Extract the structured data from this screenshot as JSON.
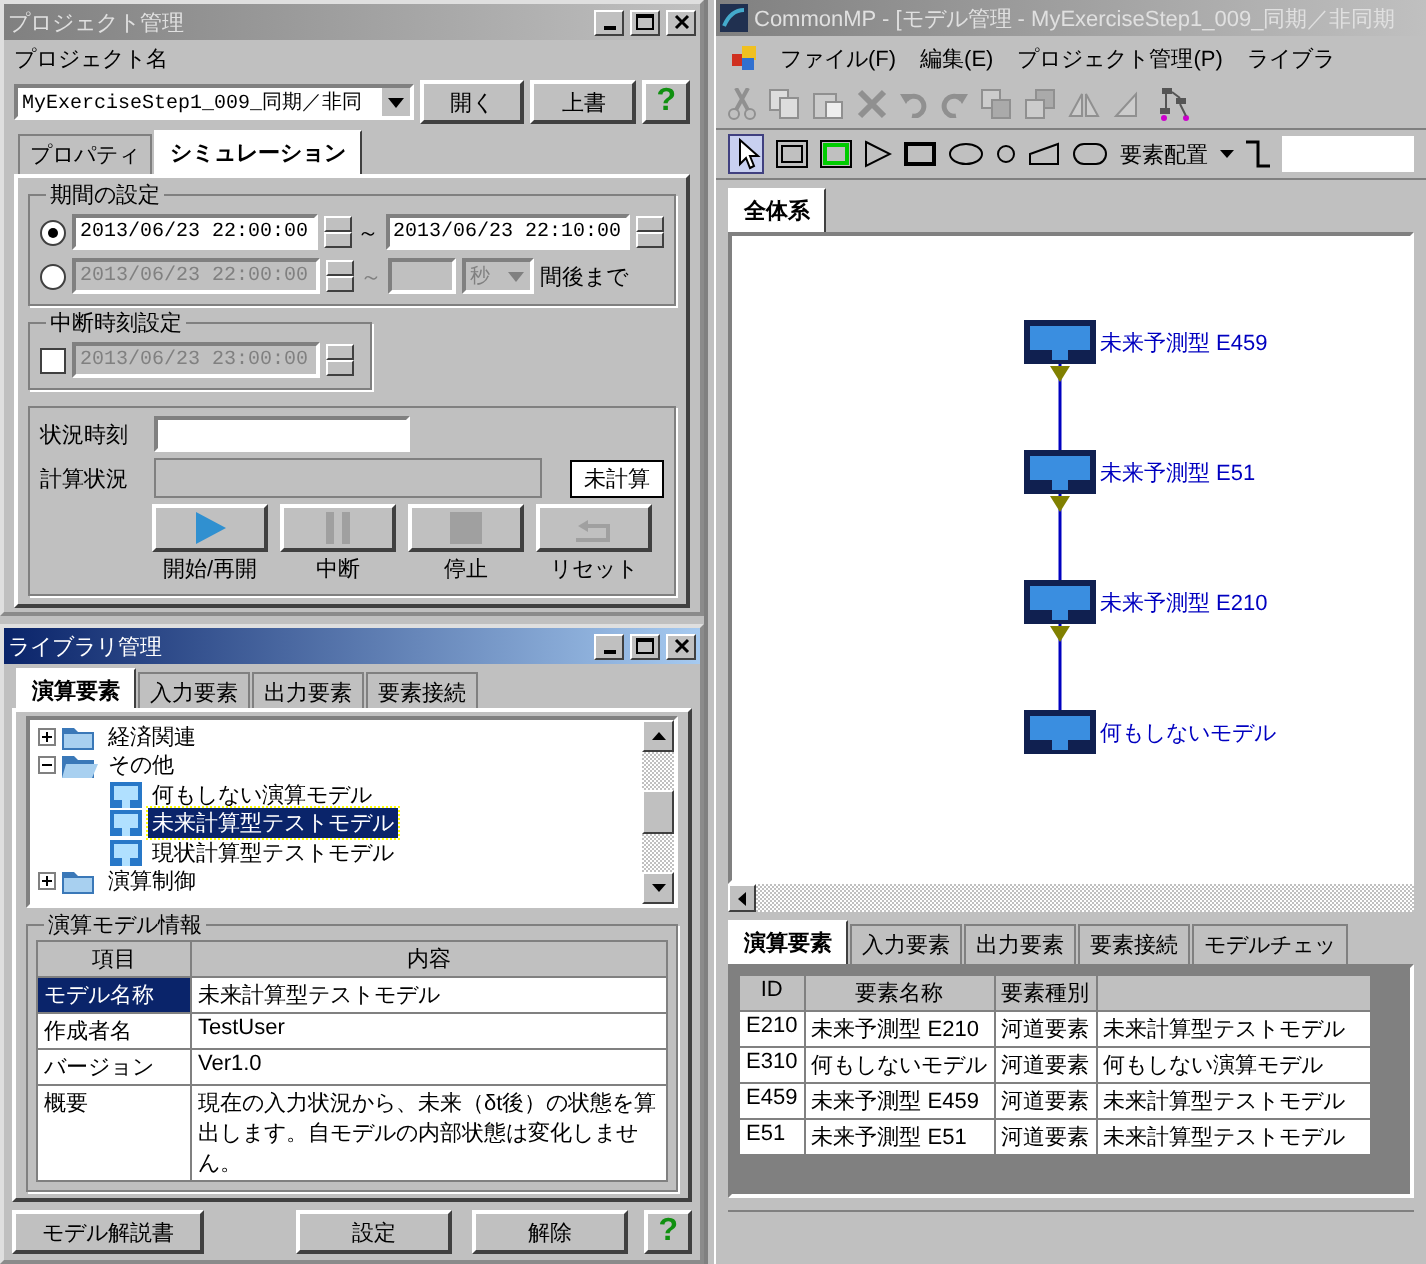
{
  "project_window": {
    "title": "プロジェクト管理",
    "active": false,
    "project_label": "プロジェクト名",
    "project_name": "MyExerciseStep1_009_同期／非同",
    "buttons": [
      "開く",
      "上書"
    ],
    "help": "?",
    "tabs": [
      {
        "label": "プロパティ",
        "selected": false
      },
      {
        "label": "シミュレーション",
        "selected": true
      }
    ],
    "period": {
      "title": "期間の設定",
      "options": [
        {
          "selected": true,
          "disabled": false,
          "start": "2013/06/23 22:00:00",
          "end": "2013/06/23 22:10:00"
        },
        {
          "selected": false,
          "disabled": true,
          "start": "2013/06/23 22:00:00",
          "unit": "秒",
          "suffix": "間後まで"
        }
      ],
      "separator": "～"
    },
    "interrupt": {
      "title": "中断時刻設定",
      "checked": false,
      "time": "2013/06/23 23:00:00"
    },
    "status_time_label": "状況時刻",
    "calc_label": "計算状況",
    "calc_progress": {
      "level": 0
    },
    "calc_status": "未計算",
    "controls": [
      {
        "kind": "play",
        "label": "開始/再開",
        "disabled": false
      },
      {
        "kind": "pause",
        "label": "中断",
        "disabled": true
      },
      {
        "kind": "stop",
        "label": "停止",
        "disabled": true
      },
      {
        "kind": "reset",
        "label": "リセット",
        "disabled": true
      }
    ]
  },
  "library_window": {
    "title": "ライブラリ管理",
    "active": true,
    "tabs": [
      {
        "label": "演算要素",
        "selected": true
      },
      {
        "label": "入力要素",
        "selected": false
      },
      {
        "label": "出力要素",
        "selected": false
      },
      {
        "label": "要素接続",
        "selected": false
      }
    ],
    "tree": [
      {
        "label": "経済関連",
        "expanded": false
      },
      {
        "label": "その他",
        "expanded": true,
        "children": [
          {
            "label": "何もしない演算モデル",
            "selected": false
          },
          {
            "label": "未来計算型テストモデル",
            "selected": true
          },
          {
            "label": "現状計算型テストモデル",
            "selected": false
          }
        ]
      },
      {
        "label": "演算制御",
        "expanded": false
      }
    ],
    "model_info": {
      "title": "演算モデル情報",
      "columns": [
        "項目",
        "内容"
      ],
      "rows": [
        {
          "label": "モデル名称",
          "value": "未来計算型テストモデル",
          "selected": true
        },
        {
          "label": "作成者名",
          "value": "TestUser",
          "selected": false
        },
        {
          "label": "バージョン",
          "value": "Ver1.0",
          "selected": false
        },
        {
          "label": "概要",
          "value": "現在の入力状況から、未来（δt後）の状態を算出します。自モデルの内部状態は変化しません。",
          "selected": false
        }
      ]
    },
    "buttons": [
      "モデル解説書",
      "設定",
      "解除"
    ],
    "help": "?"
  },
  "main_window": {
    "title": "CommonMP - [モデル管理 - MyExerciseStep1_009_同期／非同期",
    "active": false,
    "menu": [
      "ファイル(F)",
      "編集(E)",
      "プロジェクト管理(P)",
      "ライブラ"
    ],
    "layout_menu": "要素配置",
    "canvas_tab": {
      "label": "全体系",
      "selected": true
    },
    "nodes": [
      {
        "label": "未来予測型 E459"
      },
      {
        "label": "未来予測型 E51"
      },
      {
        "label": "未来予測型 E210"
      },
      {
        "label": "何もしないモデル"
      }
    ],
    "bottom_tabs": [
      {
        "label": "演算要素",
        "selected": true
      },
      {
        "label": "入力要素",
        "selected": false
      },
      {
        "label": "出力要素",
        "selected": false
      },
      {
        "label": "要素接続",
        "selected": false
      },
      {
        "label": "モデルチェッ",
        "selected": false
      }
    ],
    "table": {
      "columns": [
        "ID",
        "要素名称",
        "要素種別"
      ],
      "rows": [
        [
          "E210",
          "未来予測型 E210",
          "河道要素",
          "未来計算型テストモデル"
        ],
        [
          "E310",
          "何もしないモデル",
          "河道要素",
          "何もしない演算モデル"
        ],
        [
          "E459",
          "未来予測型 E459",
          "河道要素",
          "未来計算型テストモデル"
        ],
        [
          "E51",
          "未来予測型 E51",
          "河道要素",
          "未来計算型テストモデル"
        ]
      ]
    }
  }
}
